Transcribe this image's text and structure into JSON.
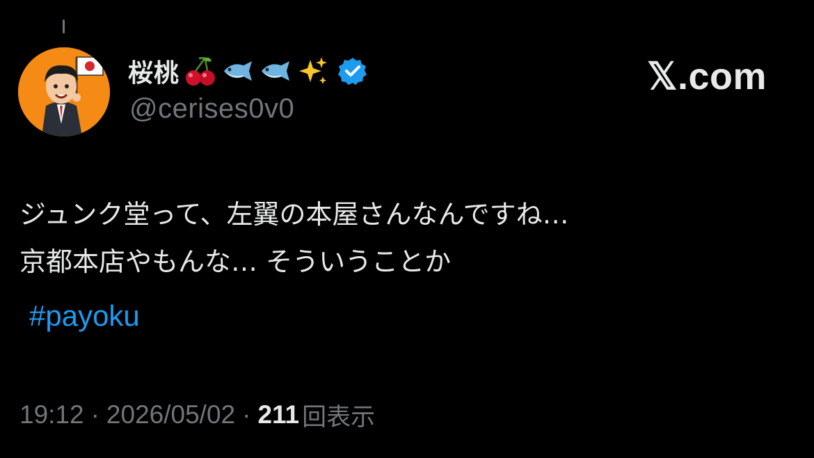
{
  "post": {
    "author": {
      "display_name": "桜桃",
      "name_emojis": [
        "cherries-icon",
        "fish-icon",
        "fish-icon",
        "sparkles-icon"
      ],
      "verified": true,
      "handle": "@cerises0v0"
    },
    "brand": "𝕏.com",
    "text_lines": [
      "ジュンク堂って、左翼の本屋さんなんですね…",
      "京都本店やもんな… そういうことか"
    ],
    "hashtag": "#payoku",
    "time": "19:12",
    "separator": "·",
    "date": "2026/05/02",
    "views_count": "211",
    "views_label": "回表示"
  },
  "colors": {
    "background": "#000000",
    "text_primary": "#e7e9ea",
    "text_secondary": "#71767b",
    "link": "#1d9bf0",
    "verified_badge": "#1d9bf0",
    "avatar_background": "#f58a14"
  }
}
